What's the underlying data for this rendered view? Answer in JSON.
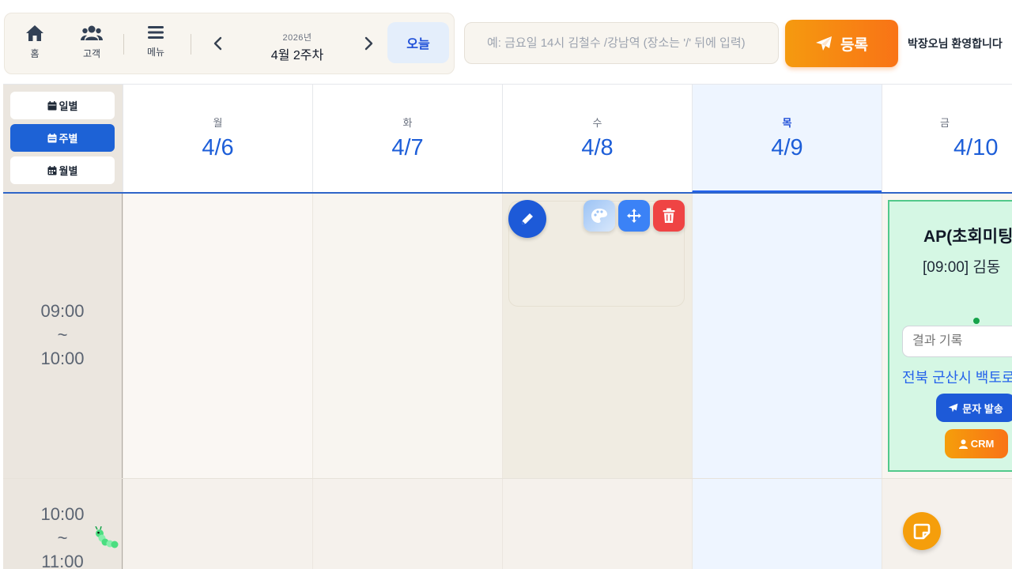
{
  "topbar": {
    "home_label": "홈",
    "customers_label": "고객",
    "menu_label": "메뉴",
    "year": "2026년",
    "week_title": "4월 2주차",
    "today_label": "오늘",
    "search_placeholder": "예: 금요일 14시 김철수 /강남역 (장소는 '/' 뒤에 입력)",
    "register_label": "등록",
    "welcome": "박장오님 환영합니다"
  },
  "views": {
    "day_label": "일별",
    "week_label": "주별",
    "month_label": "월별",
    "active": "week"
  },
  "days": [
    {
      "weekday": "월",
      "date": "4/6"
    },
    {
      "weekday": "화",
      "date": "4/7"
    },
    {
      "weekday": "수",
      "date": "4/8"
    },
    {
      "weekday": "목",
      "date": "4/9",
      "today": true
    },
    {
      "weekday": "금",
      "date": "4/10"
    }
  ],
  "time_slots": [
    {
      "start": "09:00",
      "sep": "~",
      "end": "10:00"
    },
    {
      "start": "10:00",
      "sep": "~",
      "end": "11:00"
    }
  ],
  "appointment": {
    "title": "AP(초회미팅)",
    "time_name": "[09:00] 김동",
    "result_placeholder": "결과 기록",
    "address": "전북 군산시 백토로",
    "sms_label": "문자 발송",
    "crm_label": "CRM"
  },
  "colors": {
    "primary": "#1d62d6",
    "accent": "#f97316",
    "appointment_bg": "#d5f7e4",
    "appointment_border": "#52c98b",
    "delete": "#ef4444"
  },
  "icons": {
    "home": "home-icon",
    "customers": "users-icon",
    "menu": "hamburger-icon",
    "register": "paper-plane-icon",
    "edit": "pencil-icon",
    "palette": "palette-icon",
    "move": "move-icon",
    "delete": "trash-icon",
    "chat": "chat-icon"
  }
}
